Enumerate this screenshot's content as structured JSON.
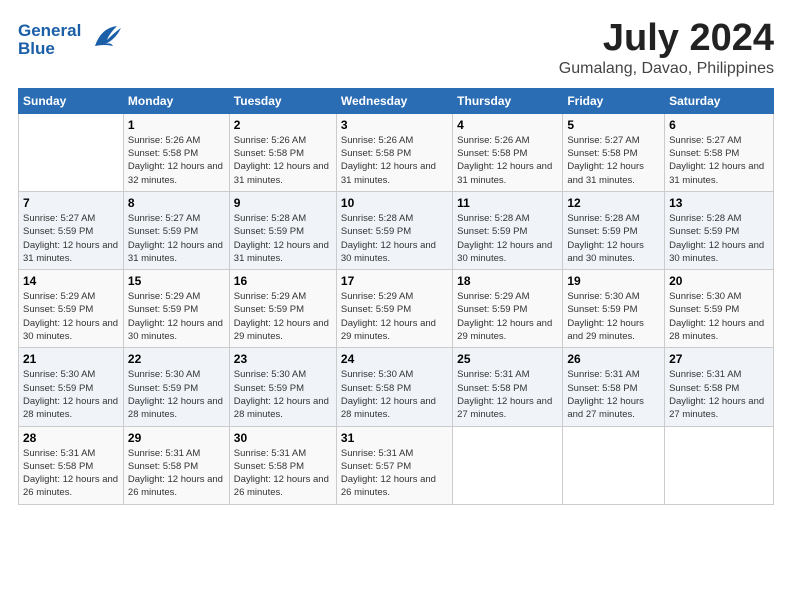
{
  "header": {
    "logo_line1": "General",
    "logo_line2": "Blue",
    "month_year": "July 2024",
    "location": "Gumalang, Davao, Philippines"
  },
  "weekdays": [
    "Sunday",
    "Monday",
    "Tuesday",
    "Wednesday",
    "Thursday",
    "Friday",
    "Saturday"
  ],
  "weeks": [
    [
      {
        "day": "",
        "sunrise": "",
        "sunset": "",
        "daylight": ""
      },
      {
        "day": "1",
        "sunrise": "Sunrise: 5:26 AM",
        "sunset": "Sunset: 5:58 PM",
        "daylight": "Daylight: 12 hours and 32 minutes."
      },
      {
        "day": "2",
        "sunrise": "Sunrise: 5:26 AM",
        "sunset": "Sunset: 5:58 PM",
        "daylight": "Daylight: 12 hours and 31 minutes."
      },
      {
        "day": "3",
        "sunrise": "Sunrise: 5:26 AM",
        "sunset": "Sunset: 5:58 PM",
        "daylight": "Daylight: 12 hours and 31 minutes."
      },
      {
        "day": "4",
        "sunrise": "Sunrise: 5:26 AM",
        "sunset": "Sunset: 5:58 PM",
        "daylight": "Daylight: 12 hours and 31 minutes."
      },
      {
        "day": "5",
        "sunrise": "Sunrise: 5:27 AM",
        "sunset": "Sunset: 5:58 PM",
        "daylight": "Daylight: 12 hours and 31 minutes."
      },
      {
        "day": "6",
        "sunrise": "Sunrise: 5:27 AM",
        "sunset": "Sunset: 5:58 PM",
        "daylight": "Daylight: 12 hours and 31 minutes."
      }
    ],
    [
      {
        "day": "7",
        "sunrise": "Sunrise: 5:27 AM",
        "sunset": "Sunset: 5:59 PM",
        "daylight": "Daylight: 12 hours and 31 minutes."
      },
      {
        "day": "8",
        "sunrise": "Sunrise: 5:27 AM",
        "sunset": "Sunset: 5:59 PM",
        "daylight": "Daylight: 12 hours and 31 minutes."
      },
      {
        "day": "9",
        "sunrise": "Sunrise: 5:28 AM",
        "sunset": "Sunset: 5:59 PM",
        "daylight": "Daylight: 12 hours and 31 minutes."
      },
      {
        "day": "10",
        "sunrise": "Sunrise: 5:28 AM",
        "sunset": "Sunset: 5:59 PM",
        "daylight": "Daylight: 12 hours and 30 minutes."
      },
      {
        "day": "11",
        "sunrise": "Sunrise: 5:28 AM",
        "sunset": "Sunset: 5:59 PM",
        "daylight": "Daylight: 12 hours and 30 minutes."
      },
      {
        "day": "12",
        "sunrise": "Sunrise: 5:28 AM",
        "sunset": "Sunset: 5:59 PM",
        "daylight": "Daylight: 12 hours and 30 minutes."
      },
      {
        "day": "13",
        "sunrise": "Sunrise: 5:28 AM",
        "sunset": "Sunset: 5:59 PM",
        "daylight": "Daylight: 12 hours and 30 minutes."
      }
    ],
    [
      {
        "day": "14",
        "sunrise": "Sunrise: 5:29 AM",
        "sunset": "Sunset: 5:59 PM",
        "daylight": "Daylight: 12 hours and 30 minutes."
      },
      {
        "day": "15",
        "sunrise": "Sunrise: 5:29 AM",
        "sunset": "Sunset: 5:59 PM",
        "daylight": "Daylight: 12 hours and 30 minutes."
      },
      {
        "day": "16",
        "sunrise": "Sunrise: 5:29 AM",
        "sunset": "Sunset: 5:59 PM",
        "daylight": "Daylight: 12 hours and 29 minutes."
      },
      {
        "day": "17",
        "sunrise": "Sunrise: 5:29 AM",
        "sunset": "Sunset: 5:59 PM",
        "daylight": "Daylight: 12 hours and 29 minutes."
      },
      {
        "day": "18",
        "sunrise": "Sunrise: 5:29 AM",
        "sunset": "Sunset: 5:59 PM",
        "daylight": "Daylight: 12 hours and 29 minutes."
      },
      {
        "day": "19",
        "sunrise": "Sunrise: 5:30 AM",
        "sunset": "Sunset: 5:59 PM",
        "daylight": "Daylight: 12 hours and 29 minutes."
      },
      {
        "day": "20",
        "sunrise": "Sunrise: 5:30 AM",
        "sunset": "Sunset: 5:59 PM",
        "daylight": "Daylight: 12 hours and 28 minutes."
      }
    ],
    [
      {
        "day": "21",
        "sunrise": "Sunrise: 5:30 AM",
        "sunset": "Sunset: 5:59 PM",
        "daylight": "Daylight: 12 hours and 28 minutes."
      },
      {
        "day": "22",
        "sunrise": "Sunrise: 5:30 AM",
        "sunset": "Sunset: 5:59 PM",
        "daylight": "Daylight: 12 hours and 28 minutes."
      },
      {
        "day": "23",
        "sunrise": "Sunrise: 5:30 AM",
        "sunset": "Sunset: 5:59 PM",
        "daylight": "Daylight: 12 hours and 28 minutes."
      },
      {
        "day": "24",
        "sunrise": "Sunrise: 5:30 AM",
        "sunset": "Sunset: 5:58 PM",
        "daylight": "Daylight: 12 hours and 28 minutes."
      },
      {
        "day": "25",
        "sunrise": "Sunrise: 5:31 AM",
        "sunset": "Sunset: 5:58 PM",
        "daylight": "Daylight: 12 hours and 27 minutes."
      },
      {
        "day": "26",
        "sunrise": "Sunrise: 5:31 AM",
        "sunset": "Sunset: 5:58 PM",
        "daylight": "Daylight: 12 hours and 27 minutes."
      },
      {
        "day": "27",
        "sunrise": "Sunrise: 5:31 AM",
        "sunset": "Sunset: 5:58 PM",
        "daylight": "Daylight: 12 hours and 27 minutes."
      }
    ],
    [
      {
        "day": "28",
        "sunrise": "Sunrise: 5:31 AM",
        "sunset": "Sunset: 5:58 PM",
        "daylight": "Daylight: 12 hours and 26 minutes."
      },
      {
        "day": "29",
        "sunrise": "Sunrise: 5:31 AM",
        "sunset": "Sunset: 5:58 PM",
        "daylight": "Daylight: 12 hours and 26 minutes."
      },
      {
        "day": "30",
        "sunrise": "Sunrise: 5:31 AM",
        "sunset": "Sunset: 5:58 PM",
        "daylight": "Daylight: 12 hours and 26 minutes."
      },
      {
        "day": "31",
        "sunrise": "Sunrise: 5:31 AM",
        "sunset": "Sunset: 5:57 PM",
        "daylight": "Daylight: 12 hours and 26 minutes."
      },
      {
        "day": "",
        "sunrise": "",
        "sunset": "",
        "daylight": ""
      },
      {
        "day": "",
        "sunrise": "",
        "sunset": "",
        "daylight": ""
      },
      {
        "day": "",
        "sunrise": "",
        "sunset": "",
        "daylight": ""
      }
    ]
  ]
}
